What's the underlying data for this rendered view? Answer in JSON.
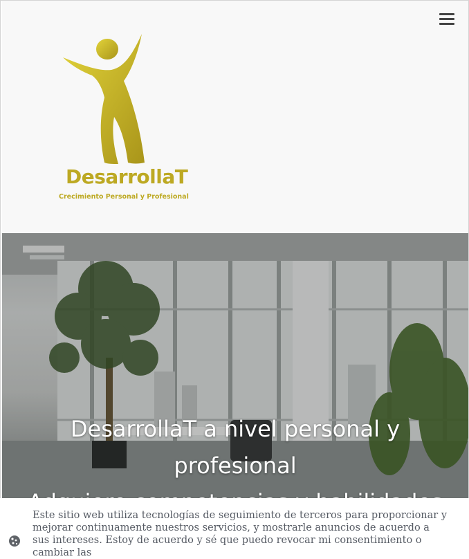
{
  "header": {
    "logo": {
      "brand_name": "DesarrollaT",
      "tagline": "Crecimiento Personal y Profesional"
    },
    "menu_icon": "hamburger-icon"
  },
  "hero": {
    "title_line_1": "DesarrollaT a nivel personal y",
    "title_line_2": "profesional",
    "title_line_3": "Adquiere competencias y habilidades"
  },
  "cookie_notice": {
    "text": "Este sitio web utiliza tecnologías de seguimiento de terceros para proporcionar y mejorar continuamente nuestros servicios, y mostrarle anuncios de acuerdo a sus intereses. Estoy de acuerdo y sé que puedo revocar mi consentimiento o cambiar las",
    "icon": "cookie-icon"
  },
  "colors": {
    "brand_gold": "#bda923",
    "header_bg": "#f8f8f8",
    "cookie_text": "#555a63"
  }
}
